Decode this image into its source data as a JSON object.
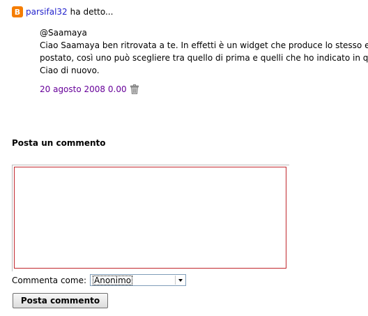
{
  "comment": {
    "author": "parsifal32",
    "said_text": "ha detto...",
    "lines": [
      "@Saamaya",
      "Ciao Saamaya ben ritrovata a te. In effetti è un widget che produce lo stesso eff",
      "postato, così uno può scegliere tra quello di prima e quelli che ho indicato in que",
      "Ciao di nuovo."
    ],
    "timestamp": "20 agosto 2008 0.00",
    "icon_blogger": "blogger-icon",
    "icon_delete": "trash-icon"
  },
  "post_comment": {
    "title": "Posta un commento",
    "textarea_value": "",
    "comment_as_label": "Commenta come:",
    "identity_selected": "Anonimo",
    "submit_label": "Posta commento"
  },
  "colors": {
    "author_link": "#2222cc",
    "timestamp_link": "#660099",
    "blogger_orange": "#f57d00",
    "textarea_border": "#c1272d"
  }
}
